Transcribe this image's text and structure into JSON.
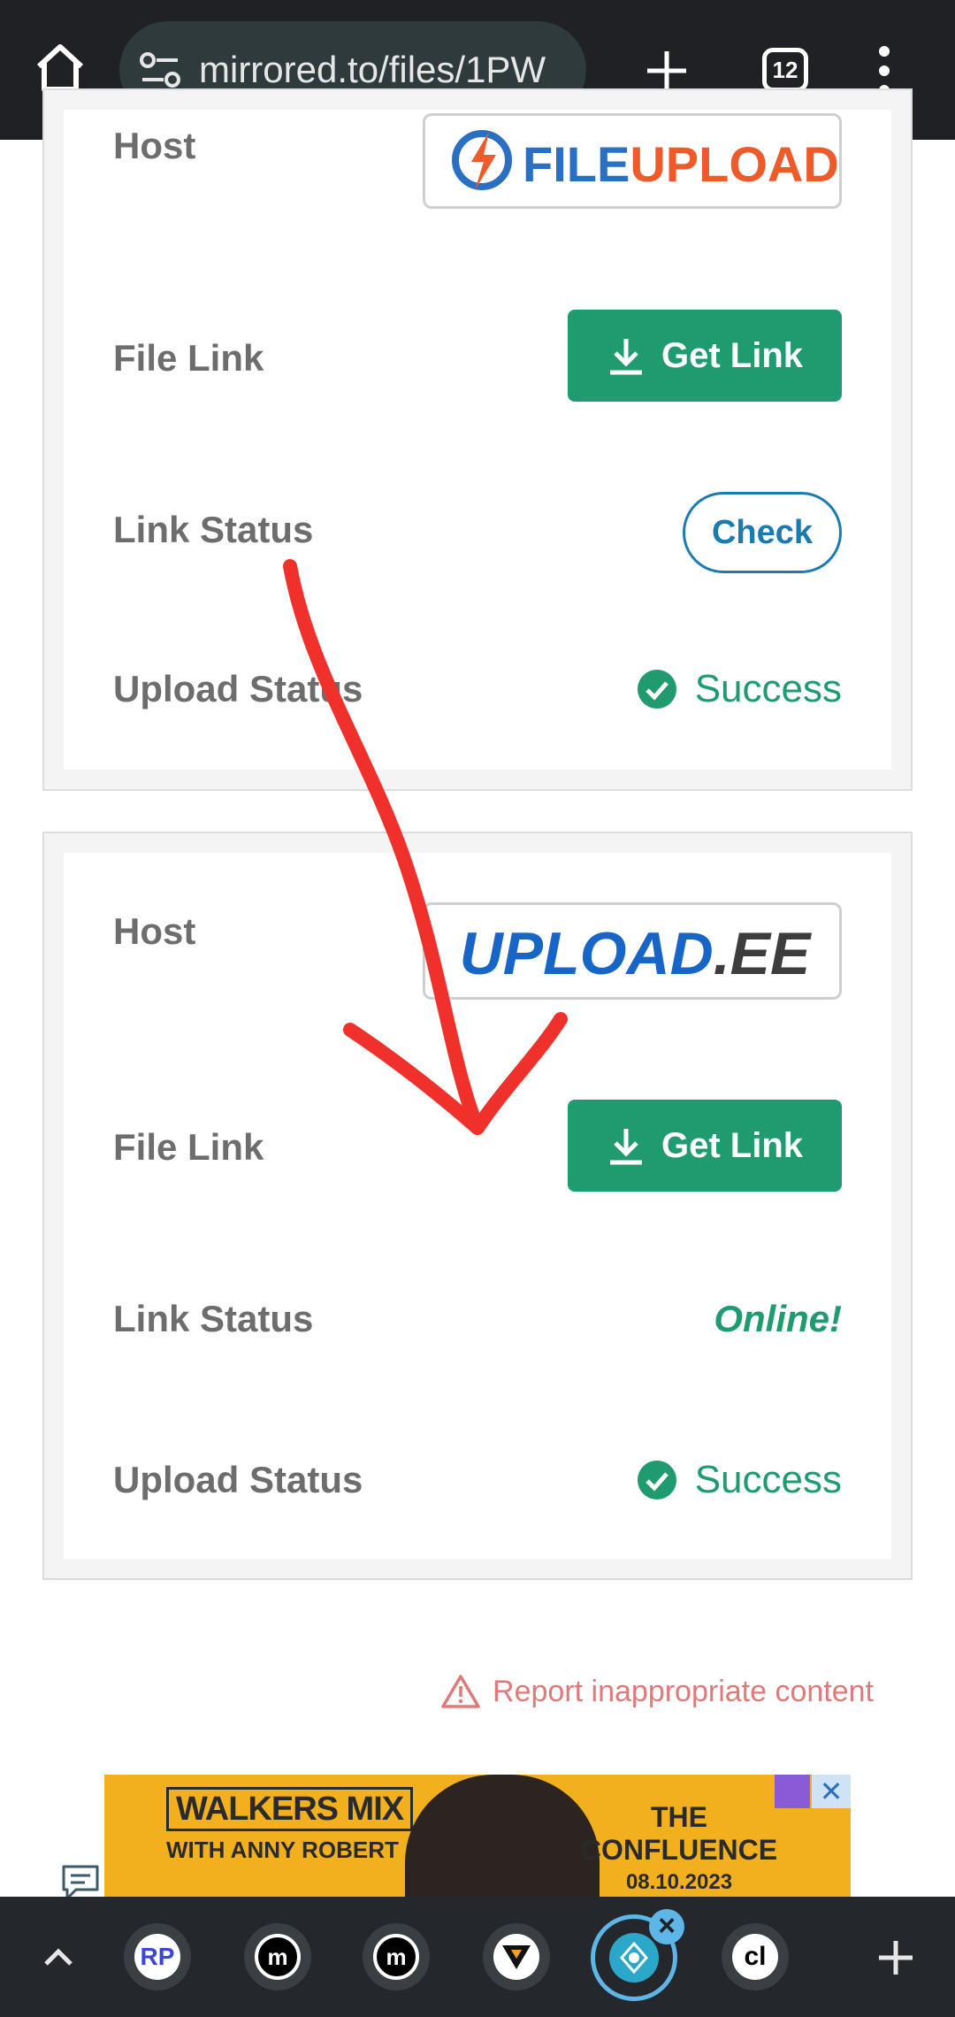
{
  "browser": {
    "url": "mirrored.to/files/1PW",
    "tab_count": "12"
  },
  "cards": [
    {
      "host_label": "Host",
      "host_logo_text": "FILEUPLOAD",
      "file_link_label": "File Link",
      "get_link_label": "Get Link",
      "link_status_label": "Link Status",
      "check_label": "Check",
      "upload_status_label": "Upload Status",
      "upload_status_value": "Success"
    },
    {
      "host_label": "Host",
      "host_logo_text": "UPLOAD.EE",
      "file_link_label": "File Link",
      "get_link_label": "Get Link",
      "link_status_label": "Link Status",
      "link_status_value": "Online!",
      "upload_status_label": "Upload Status",
      "upload_status_value": "Success"
    }
  ],
  "report_label": "Report inappropriate content",
  "ad": {
    "left_title": "WALKERS MIX",
    "left_subtitle": "WITH ANNY ROBERT",
    "right_title": "THE CONFLUENCE",
    "right_date": "08.10.2023",
    "close_glyph": "✕"
  },
  "bottom_tabs": [
    {
      "icon": "rp-favicon",
      "label": "RP"
    },
    {
      "icon": "m-favicon",
      "label": "m"
    },
    {
      "icon": "m-favicon",
      "label": "m"
    },
    {
      "icon": "triangle-favicon",
      "label": ""
    },
    {
      "icon": "active-site-favicon",
      "label": ""
    },
    {
      "icon": "cl-favicon",
      "label": "cl"
    }
  ],
  "colors": {
    "accent_green": "#1f9b6f",
    "check_blue": "#1a7bb0",
    "report_red": "#e07a7a",
    "annotation_red": "#f0302a"
  }
}
